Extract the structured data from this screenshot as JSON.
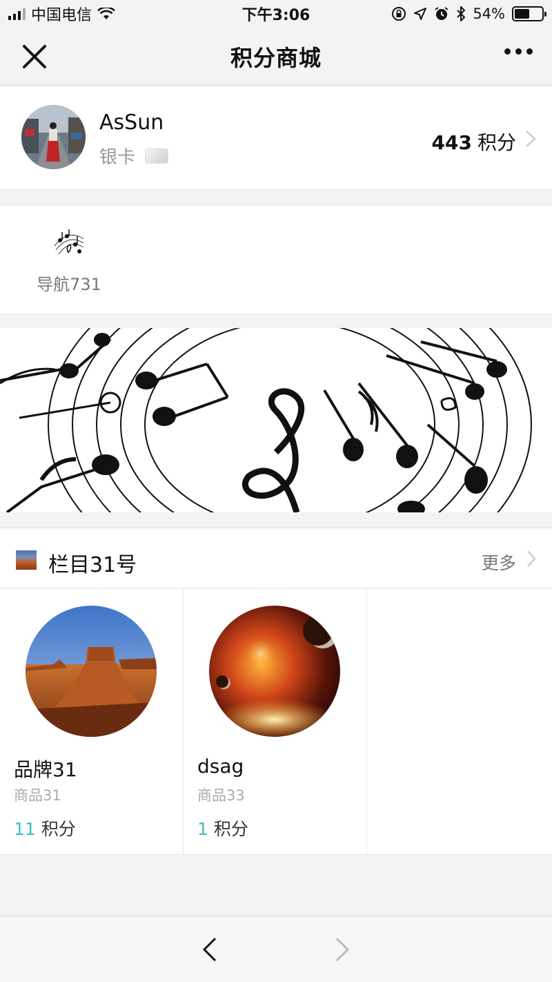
{
  "status_bar": {
    "carrier": "中国电信",
    "time": "下午3:06",
    "battery_text": "54%",
    "battery_level": 0.54
  },
  "nav": {
    "title": "积分商城"
  },
  "user": {
    "name": "AsSun",
    "level": "银卡",
    "points_value": "443",
    "points_unit": "积分"
  },
  "shortcuts": [
    {
      "label": "导航731",
      "icon": "music-notes-icon"
    }
  ],
  "section": {
    "title": "栏目31号",
    "more_label": "更多"
  },
  "products": [
    {
      "name": "品牌31",
      "subtitle": "商品31",
      "price": "11",
      "price_unit": "积分",
      "image": "desert-butte-image"
    },
    {
      "name": "dsag",
      "subtitle": "商品33",
      "price": "1",
      "price_unit": "积分",
      "image": "nebula-planets-image"
    }
  ],
  "colors": {
    "accent": "#3cbfbf",
    "background": "#f3f3f5"
  }
}
